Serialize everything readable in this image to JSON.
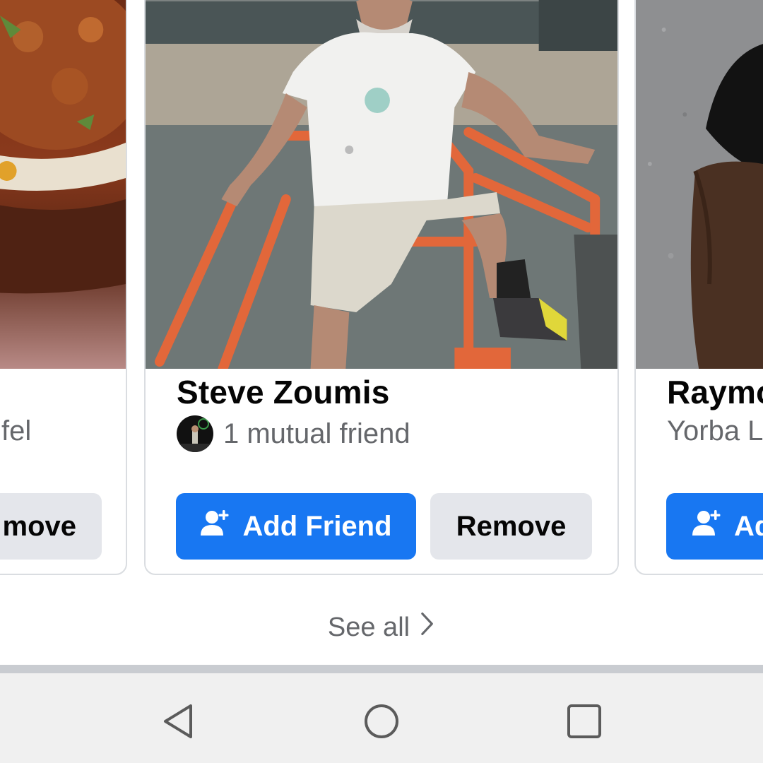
{
  "cards": {
    "left": {
      "subtitle_fragment": "fel",
      "remove_label": "move"
    },
    "center": {
      "name": "Steve Zoumis",
      "mutual": "1 mutual friend",
      "add_label": "Add Friend",
      "remove_label": "Remove"
    },
    "right": {
      "name": "Raymo",
      "subtitle": "Yorba L",
      "add_label": "Ad"
    }
  },
  "see_all": {
    "label": "See all",
    "icon": "chevron-right-icon"
  },
  "nav": {
    "back_icon": "back-triangle-icon",
    "home_icon": "home-circle-icon",
    "recents_icon": "recents-square-icon"
  },
  "colors": {
    "primary": "#1877f2",
    "secondary_bg": "#e4e6eb",
    "muted_text": "#65676b",
    "border": "#dadde1"
  }
}
